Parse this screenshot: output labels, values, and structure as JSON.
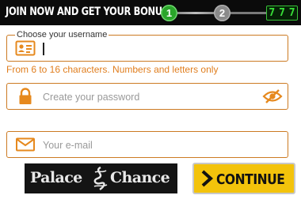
{
  "header": {
    "title": "JOIN NOW AND GET YOUR BONUS",
    "steps": [
      "1",
      "2"
    ],
    "active_step": 1,
    "slot_symbols": [
      "7",
      "7",
      "7"
    ]
  },
  "form": {
    "username": {
      "label": "Choose your username",
      "value": "",
      "hint": "From 6 to 16 characters. Numbers and letters only"
    },
    "password": {
      "placeholder": "Create your password",
      "value": ""
    },
    "email": {
      "placeholder": "Your e-mail",
      "value": ""
    }
  },
  "footer": {
    "logo_logo_text_left": "Palace",
    "logo_text_right": "Chance",
    "continue_label": "CONTINUE"
  },
  "colors": {
    "accent": "#e07e1e",
    "button": "#f3c30b",
    "step_active": "#2aa52a",
    "step_inactive": "#8a8a8a"
  }
}
